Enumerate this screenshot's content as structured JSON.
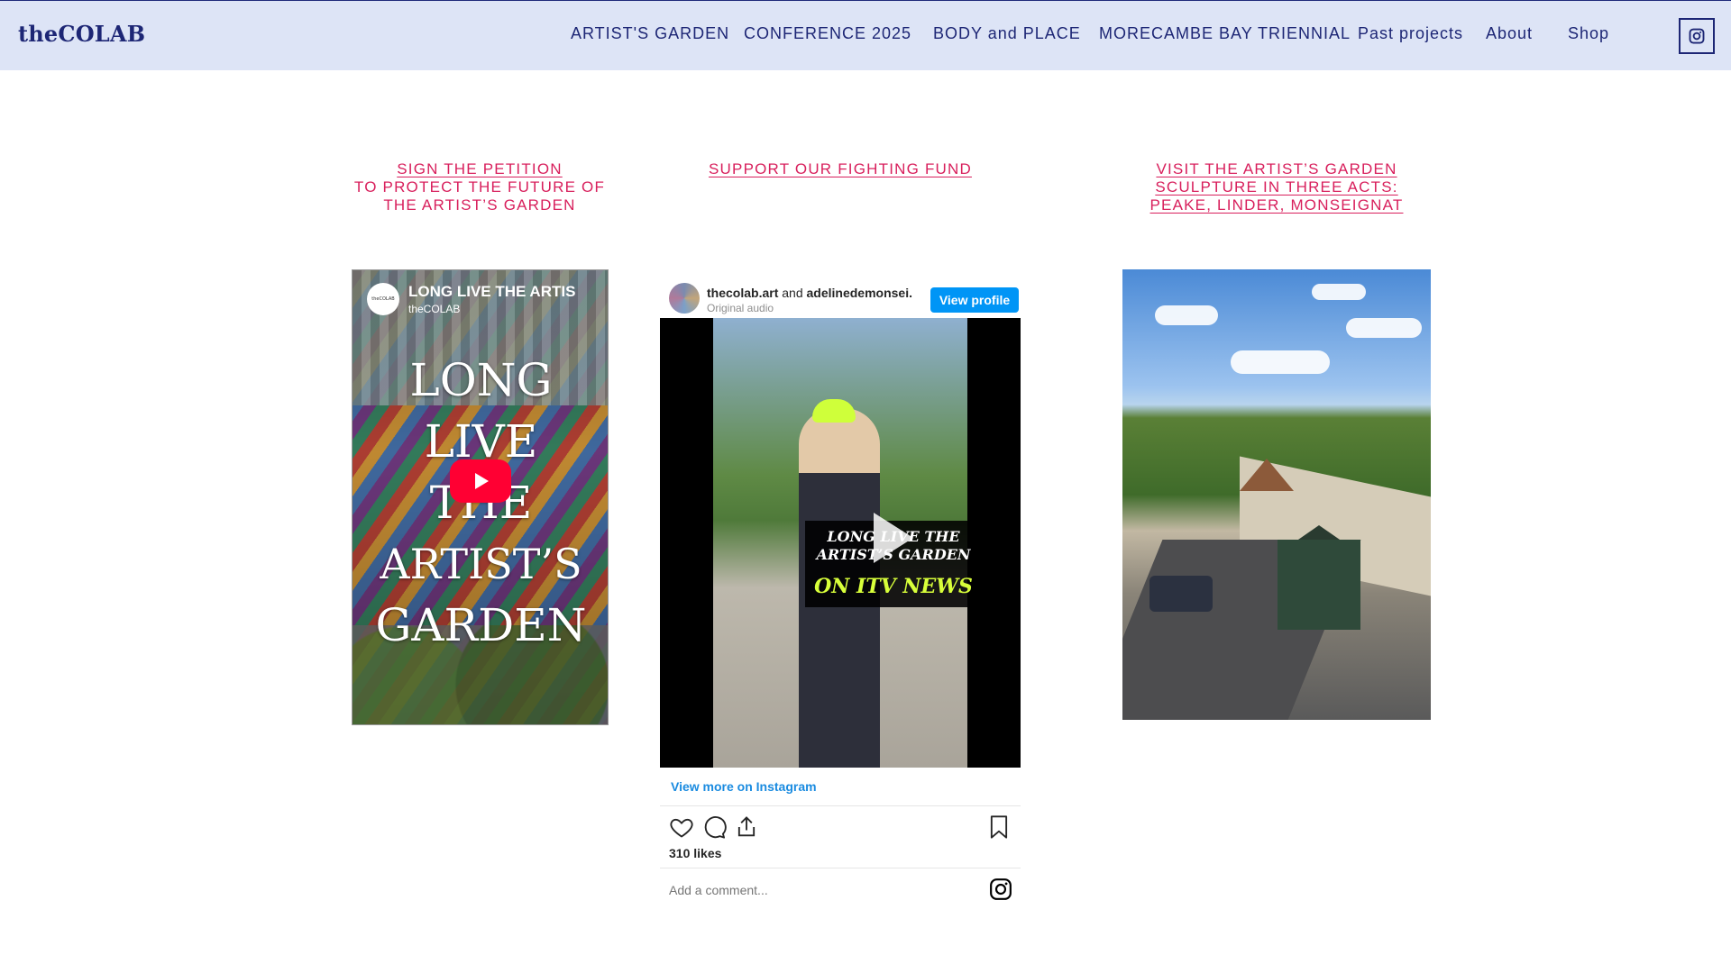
{
  "header": {
    "logo": "theCOLAB",
    "nav": [
      {
        "label": "ARTIST'S GARDEN"
      },
      {
        "label": "CONFERENCE 2025"
      },
      {
        "label": "BODY and PLACE"
      },
      {
        "label": "MORECAMBE BAY TRIENNIAL"
      },
      {
        "label": "Past projects"
      },
      {
        "label": "About"
      },
      {
        "label": "Shop"
      }
    ],
    "instagram_icon": "instagram-icon"
  },
  "cta": {
    "petition": {
      "line1": "SIGN THE PETITION",
      "line2": "TO PROTECT THE FUTURE OF",
      "line3": "THE ARTIST’S GARDEN"
    },
    "fund": {
      "line1": "SUPPORT OUR FIGHTING FUND"
    },
    "visit": {
      "line1": "VISIT THE ARTIST’S GARDEN",
      "line2": "SCULPTURE IN THREE ACTS:",
      "line3": "PEAKE, LINDER, MONSEIGNAT"
    }
  },
  "youtube": {
    "channel_avatar": "theCOLAB",
    "title": "LONG LIVE THE ARTIS",
    "channel": "theCOLAB",
    "overlay_lines": [
      "LONG",
      "LIVE",
      "THE",
      "ARTIST’S",
      "GARDEN"
    ]
  },
  "instagram": {
    "user1": "thecolab.art",
    "and": "and",
    "user2": "adelinedemonsei.",
    "subtitle": "Original audio",
    "view_profile": "View profile",
    "video_line1": "LONG LIVE THE",
    "video_line2": "ARTIST’S GARDEN",
    "video_line3": "ON ITV NEWS",
    "view_more": "View more on Instagram",
    "likes": "310 likes",
    "comment_placeholder": "Add a comment..."
  },
  "colors": {
    "accent": "#d81f5c",
    "header_bg": "#dde4f6",
    "nav_text": "#1d2675",
    "instagram_blue": "#0095f6"
  }
}
